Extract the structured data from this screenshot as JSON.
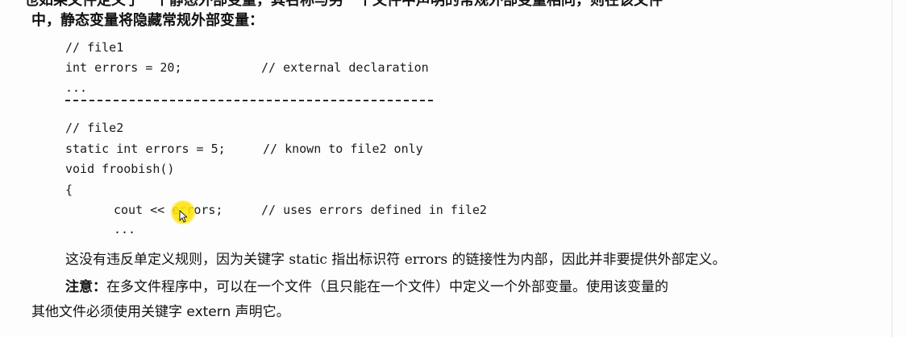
{
  "header_cutoff": "也如果文件定义了一个静态外部变量，其名称与另一个文件中声明的常规外部变量相同，则在该文件",
  "intro_line": "中，静态变量将隐藏常规外部变量：",
  "code": {
    "file1_comment": "// file1",
    "file1_decl": "int errors = 20;",
    "file1_decl_comment": "// external declaration",
    "file1_ellipsis": "...",
    "file2_comment": "// file2",
    "file2_static": "static int errors = 5;",
    "file2_static_comment": "// known to file2 only",
    "func_sig": "void froobish()",
    "open_brace": "{",
    "cout_line": "cout << errors;",
    "cout_comment": "// uses errors defined in file2",
    "inner_ellipsis": "..."
  },
  "explanation": "这没有违反单定义规则，因为关键字 static 指出标识符 errors 的链接性为内部，因此并非要提供外部定义。",
  "note": {
    "label": "注意：",
    "line1": "在多文件程序中，可以在一个文件（且只能在一个文件）中定义一个外部变量。使用该变量的",
    "line2": "其他文件必须使用关键字 extern 声明它。"
  }
}
